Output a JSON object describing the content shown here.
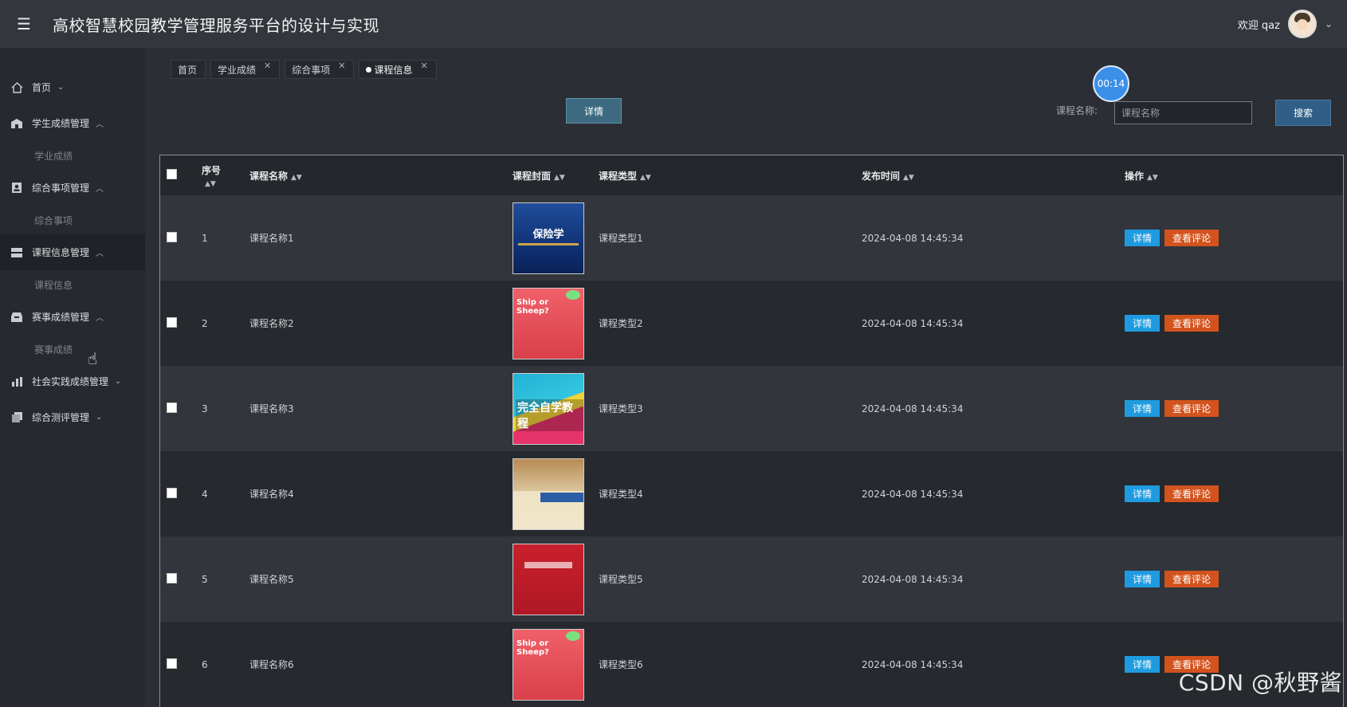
{
  "header": {
    "title": "高校智慧校园教学管理服务平台的设计与实现",
    "welcome": "欢迎 qaz"
  },
  "sidebar": {
    "items": [
      {
        "label": "首页",
        "icon": "home-icon",
        "expanded": false,
        "children": []
      },
      {
        "label": "学生成绩管理",
        "icon": "building-icon",
        "expanded": true,
        "children": [
          "学业成绩"
        ]
      },
      {
        "label": "综合事项管理",
        "icon": "id-card-icon",
        "expanded": true,
        "children": [
          "综合事项"
        ]
      },
      {
        "label": "课程信息管理",
        "icon": "server-icon",
        "expanded": true,
        "children": [
          "课程信息"
        ]
      },
      {
        "label": "赛事成绩管理",
        "icon": "inbox-icon",
        "expanded": true,
        "children": [
          "赛事成绩"
        ]
      },
      {
        "label": "社会实践成绩管理",
        "icon": "bar-chart-icon",
        "expanded": false,
        "children": []
      },
      {
        "label": "综合测评管理",
        "icon": "copy-icon",
        "expanded": false,
        "children": []
      }
    ]
  },
  "tabs": [
    {
      "label": "首页",
      "closable": false,
      "active": false
    },
    {
      "label": "学业成绩",
      "closable": true,
      "active": false
    },
    {
      "label": "综合事项",
      "closable": true,
      "active": false
    },
    {
      "label": "课程信息",
      "closable": true,
      "active": true
    }
  ],
  "timer": "00:14",
  "toolbar": {
    "detail_label": "详情",
    "search_label": "课程名称:",
    "search_placeholder": "课程名称",
    "search_button": "搜索"
  },
  "table": {
    "columns": [
      "序号",
      "课程名称",
      "课程封面",
      "课程类型",
      "发布时间",
      "操作"
    ],
    "rows": [
      {
        "index": "1",
        "name": "课程名称1",
        "cover": "保险学",
        "type": "课程类型1",
        "time": "2024-04-08 14:45:34"
      },
      {
        "index": "2",
        "name": "课程名称2",
        "cover": "Ship or Sheep?",
        "type": "课程类型2",
        "time": "2024-04-08 14:45:34"
      },
      {
        "index": "3",
        "name": "课程名称3",
        "cover": "完全自学教程",
        "type": "课程类型3",
        "time": "2024-04-08 14:45:34"
      },
      {
        "index": "4",
        "name": "课程名称4",
        "cover": "",
        "type": "课程类型4",
        "time": "2024-04-08 14:45:34"
      },
      {
        "index": "5",
        "name": "课程名称5",
        "cover": "",
        "type": "课程类型5",
        "time": "2024-04-08 14:45:34"
      },
      {
        "index": "6",
        "name": "课程名称6",
        "cover": "Ship or Sheep?",
        "type": "课程类型6",
        "time": "2024-04-08 14:45:34"
      }
    ],
    "op_detail": "详情",
    "op_comment": "查看评论"
  },
  "watermark": "CSDN @秋野酱"
}
